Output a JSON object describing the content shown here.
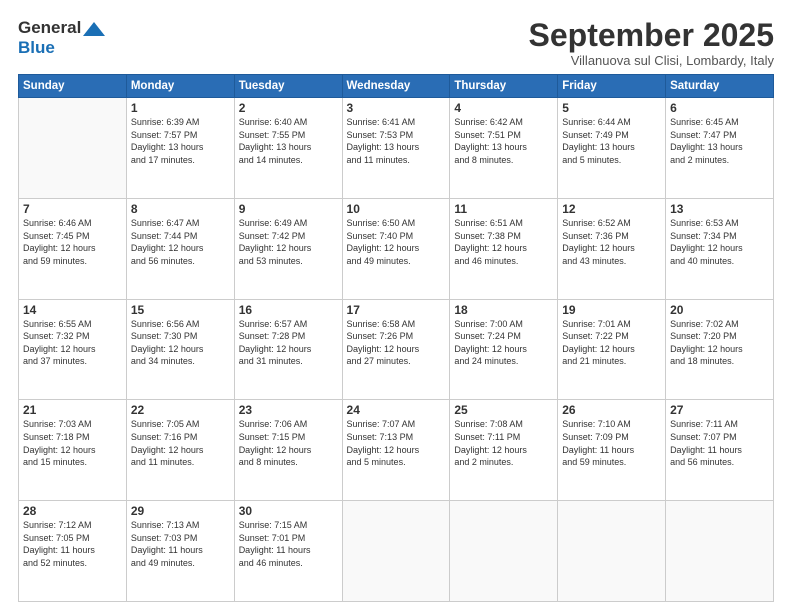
{
  "header": {
    "logo_general": "General",
    "logo_blue": "Blue",
    "month_title": "September 2025",
    "subtitle": "Villanuova sul Clisi, Lombardy, Italy"
  },
  "days": [
    "Sunday",
    "Monday",
    "Tuesday",
    "Wednesday",
    "Thursday",
    "Friday",
    "Saturday"
  ],
  "weeks": [
    [
      {
        "day": "",
        "info": ""
      },
      {
        "day": "1",
        "info": "Sunrise: 6:39 AM\nSunset: 7:57 PM\nDaylight: 13 hours\nand 17 minutes."
      },
      {
        "day": "2",
        "info": "Sunrise: 6:40 AM\nSunset: 7:55 PM\nDaylight: 13 hours\nand 14 minutes."
      },
      {
        "day": "3",
        "info": "Sunrise: 6:41 AM\nSunset: 7:53 PM\nDaylight: 13 hours\nand 11 minutes."
      },
      {
        "day": "4",
        "info": "Sunrise: 6:42 AM\nSunset: 7:51 PM\nDaylight: 13 hours\nand 8 minutes."
      },
      {
        "day": "5",
        "info": "Sunrise: 6:44 AM\nSunset: 7:49 PM\nDaylight: 13 hours\nand 5 minutes."
      },
      {
        "day": "6",
        "info": "Sunrise: 6:45 AM\nSunset: 7:47 PM\nDaylight: 13 hours\nand 2 minutes."
      }
    ],
    [
      {
        "day": "7",
        "info": "Sunrise: 6:46 AM\nSunset: 7:45 PM\nDaylight: 12 hours\nand 59 minutes."
      },
      {
        "day": "8",
        "info": "Sunrise: 6:47 AM\nSunset: 7:44 PM\nDaylight: 12 hours\nand 56 minutes."
      },
      {
        "day": "9",
        "info": "Sunrise: 6:49 AM\nSunset: 7:42 PM\nDaylight: 12 hours\nand 53 minutes."
      },
      {
        "day": "10",
        "info": "Sunrise: 6:50 AM\nSunset: 7:40 PM\nDaylight: 12 hours\nand 49 minutes."
      },
      {
        "day": "11",
        "info": "Sunrise: 6:51 AM\nSunset: 7:38 PM\nDaylight: 12 hours\nand 46 minutes."
      },
      {
        "day": "12",
        "info": "Sunrise: 6:52 AM\nSunset: 7:36 PM\nDaylight: 12 hours\nand 43 minutes."
      },
      {
        "day": "13",
        "info": "Sunrise: 6:53 AM\nSunset: 7:34 PM\nDaylight: 12 hours\nand 40 minutes."
      }
    ],
    [
      {
        "day": "14",
        "info": "Sunrise: 6:55 AM\nSunset: 7:32 PM\nDaylight: 12 hours\nand 37 minutes."
      },
      {
        "day": "15",
        "info": "Sunrise: 6:56 AM\nSunset: 7:30 PM\nDaylight: 12 hours\nand 34 minutes."
      },
      {
        "day": "16",
        "info": "Sunrise: 6:57 AM\nSunset: 7:28 PM\nDaylight: 12 hours\nand 31 minutes."
      },
      {
        "day": "17",
        "info": "Sunrise: 6:58 AM\nSunset: 7:26 PM\nDaylight: 12 hours\nand 27 minutes."
      },
      {
        "day": "18",
        "info": "Sunrise: 7:00 AM\nSunset: 7:24 PM\nDaylight: 12 hours\nand 24 minutes."
      },
      {
        "day": "19",
        "info": "Sunrise: 7:01 AM\nSunset: 7:22 PM\nDaylight: 12 hours\nand 21 minutes."
      },
      {
        "day": "20",
        "info": "Sunrise: 7:02 AM\nSunset: 7:20 PM\nDaylight: 12 hours\nand 18 minutes."
      }
    ],
    [
      {
        "day": "21",
        "info": "Sunrise: 7:03 AM\nSunset: 7:18 PM\nDaylight: 12 hours\nand 15 minutes."
      },
      {
        "day": "22",
        "info": "Sunrise: 7:05 AM\nSunset: 7:16 PM\nDaylight: 12 hours\nand 11 minutes."
      },
      {
        "day": "23",
        "info": "Sunrise: 7:06 AM\nSunset: 7:15 PM\nDaylight: 12 hours\nand 8 minutes."
      },
      {
        "day": "24",
        "info": "Sunrise: 7:07 AM\nSunset: 7:13 PM\nDaylight: 12 hours\nand 5 minutes."
      },
      {
        "day": "25",
        "info": "Sunrise: 7:08 AM\nSunset: 7:11 PM\nDaylight: 12 hours\nand 2 minutes."
      },
      {
        "day": "26",
        "info": "Sunrise: 7:10 AM\nSunset: 7:09 PM\nDaylight: 11 hours\nand 59 minutes."
      },
      {
        "day": "27",
        "info": "Sunrise: 7:11 AM\nSunset: 7:07 PM\nDaylight: 11 hours\nand 56 minutes."
      }
    ],
    [
      {
        "day": "28",
        "info": "Sunrise: 7:12 AM\nSunset: 7:05 PM\nDaylight: 11 hours\nand 52 minutes."
      },
      {
        "day": "29",
        "info": "Sunrise: 7:13 AM\nSunset: 7:03 PM\nDaylight: 11 hours\nand 49 minutes."
      },
      {
        "day": "30",
        "info": "Sunrise: 7:15 AM\nSunset: 7:01 PM\nDaylight: 11 hours\nand 46 minutes."
      },
      {
        "day": "",
        "info": ""
      },
      {
        "day": "",
        "info": ""
      },
      {
        "day": "",
        "info": ""
      },
      {
        "day": "",
        "info": ""
      }
    ]
  ]
}
